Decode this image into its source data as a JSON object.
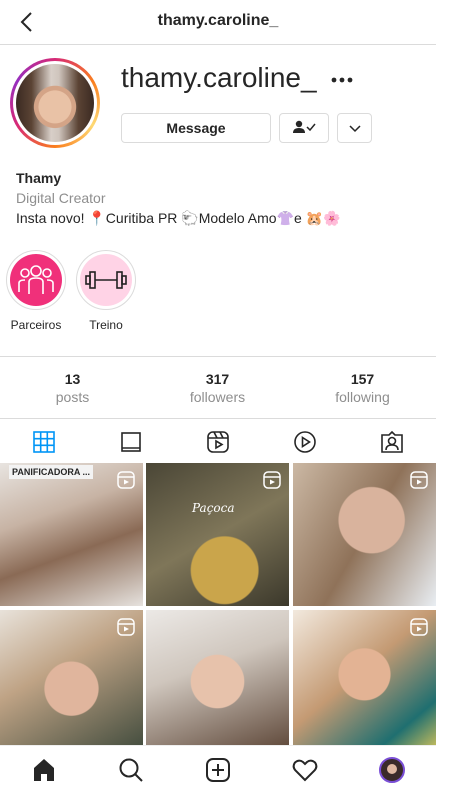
{
  "header": {
    "title": "thamy.caroline_"
  },
  "profile": {
    "username": "thamy.caroline_",
    "message_label": "Message",
    "bio_name": "Thamy",
    "bio_category": "Digital Creator",
    "bio_text": "Insta novo! 📍Curitiba PR 🐑Modelo Amo👚e 🐹🌸"
  },
  "highlights": [
    {
      "label": "Parceiros",
      "icon": "people-icon",
      "color": "#f0307a"
    },
    {
      "label": "Treino",
      "icon": "dumbbell-icon",
      "color": "#ffd3e6"
    }
  ],
  "stats": [
    {
      "value": "13",
      "label": "posts"
    },
    {
      "value": "317",
      "label": "followers"
    },
    {
      "value": "157",
      "label": "following"
    }
  ],
  "tabs": [
    "grid-icon",
    "igtv-icon",
    "reels-icon",
    "video-icon",
    "tagged-icon"
  ],
  "posts": [
    {
      "tag": "PANIFICADORA ...",
      "reel": true
    },
    {
      "caption": "Paçoca",
      "reel": true
    },
    {
      "reel": true
    },
    {
      "reel": true
    },
    {
      "reel": false
    },
    {
      "reel": true
    }
  ],
  "bottom_nav": [
    "home-icon",
    "search-icon",
    "new-post-icon",
    "activity-icon",
    "profile-icon"
  ],
  "colors": {
    "accent": "#0095f6",
    "border": "#dbdbdb",
    "muted": "#8e8e8e"
  }
}
